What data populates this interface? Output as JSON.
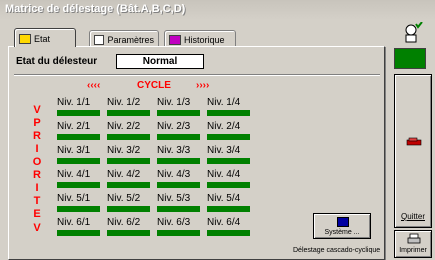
{
  "window": {
    "title": "Matrice de délestage (Bât.A,B,C,D)"
  },
  "tabs": [
    {
      "label": "Etat"
    },
    {
      "label": "Paramètres"
    },
    {
      "label": "Historique"
    }
  ],
  "etat": {
    "label": "Etat du délesteur",
    "value": "Normal"
  },
  "cycle": {
    "left_arrows": "‹‹‹‹",
    "label": "CYCLE",
    "right_arrows": "››››"
  },
  "priorite": {
    "top_arrow": "V",
    "letters": [
      "P",
      "R",
      "I",
      "O",
      "R",
      "I",
      "T",
      "E"
    ],
    "bottom_arrow": "V"
  },
  "matrix": {
    "rows": [
      [
        "Niv. 1/1",
        "Niv. 1/2",
        "Niv. 1/3",
        "Niv. 1/4"
      ],
      [
        "Niv. 2/1",
        "Niv. 2/2",
        "Niv. 2/3",
        "Niv. 2/4"
      ],
      [
        "Niv. 3/1",
        "Niv. 3/2",
        "Niv. 3/3",
        "Niv. 3/4"
      ],
      [
        "Niv. 4/1",
        "Niv. 4/2",
        "Niv. 4/3",
        "Niv. 4/4"
      ],
      [
        "Niv. 5/1",
        "Niv. 5/2",
        "Niv. 5/3",
        "Niv. 5/4"
      ],
      [
        "Niv. 6/1",
        "Niv. 6/2",
        "Niv. 6/3",
        "Niv. 6/4"
      ]
    ],
    "bar_color": "#008000"
  },
  "system_button": {
    "label": "Système ..."
  },
  "status": {
    "text": "Délestage cascado-cyclique"
  },
  "sidebar": {
    "indicator_color": "#008000",
    "quit_label": "Quitter",
    "print_label": "Imprimer",
    "top_icon": "person-ok-icon",
    "quit_icon": "exit-icon",
    "print_icon": "printer-icon"
  }
}
